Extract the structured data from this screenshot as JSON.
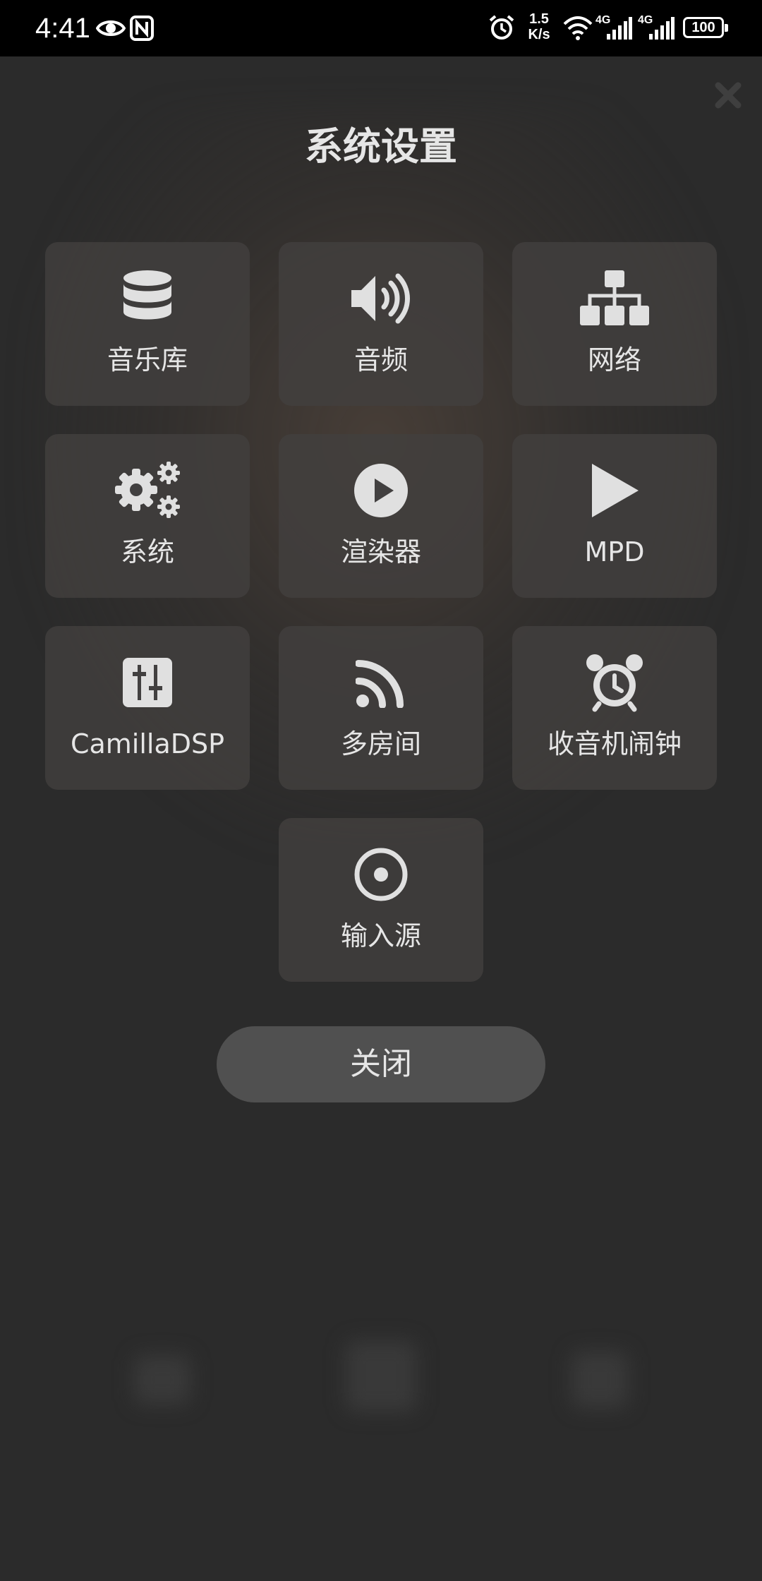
{
  "status_bar": {
    "time": "4:41",
    "speed_value": "1.5",
    "speed_unit": "K/s",
    "network_1": "4G",
    "network_2": "4G",
    "battery": "100",
    "icons": [
      "eye-icon",
      "nfc-icon",
      "alarm-icon",
      "wifi-icon",
      "signal-icon",
      "signal-icon",
      "battery-icon"
    ]
  },
  "dialog": {
    "title": "系统设置",
    "close_icon": "close-icon",
    "tiles": [
      {
        "label": "音乐库",
        "icon": "database-icon"
      },
      {
        "label": "音频",
        "icon": "speaker-icon"
      },
      {
        "label": "网络",
        "icon": "network-icon"
      },
      {
        "label": "系统",
        "icon": "gears-icon"
      },
      {
        "label": "渲染器",
        "icon": "play-circle-icon"
      },
      {
        "label": "MPD",
        "icon": "play-icon"
      },
      {
        "label": "CamillaDSP",
        "icon": "sliders-icon"
      },
      {
        "label": "多房间",
        "icon": "rss-icon"
      },
      {
        "label": "收音机闹钟",
        "icon": "alarm-clock-icon"
      },
      {
        "label": "输入源",
        "icon": "input-source-icon"
      }
    ],
    "close_button": "关闭"
  },
  "colors": {
    "background": "#2b2b2b",
    "tile": "#424040",
    "button": "#505050",
    "text": "#e6e6e6",
    "icon": "#e0e0e0"
  }
}
